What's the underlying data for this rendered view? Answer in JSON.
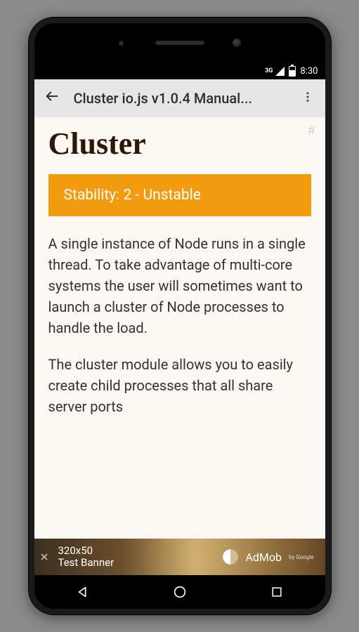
{
  "statusbar": {
    "network": "3G",
    "time": "8:30"
  },
  "appbar": {
    "title": "Cluster io.js v1.0.4 Manual..."
  },
  "page": {
    "heading": "Cluster",
    "hash": "#",
    "stability": "Stability: 2 - Unstable",
    "paragraph1": "A single instance of Node runs in a single thread. To take advantage of multi-core systems the user will sometimes want to launch a cluster of Node processes to handle the load.",
    "paragraph2": "The cluster module allows you to easily create child processes that all share server ports"
  },
  "ad": {
    "size_line1": "320x50",
    "size_line2": "Test Banner",
    "brand": "AdMob",
    "byline": "by Google"
  }
}
